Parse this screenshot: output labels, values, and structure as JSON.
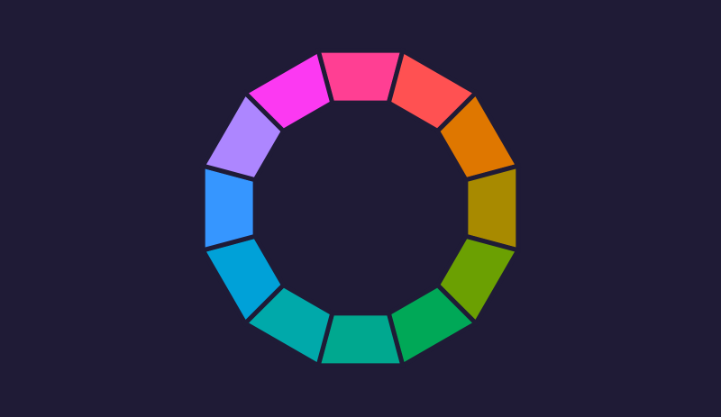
{
  "background_color": "#1f1b36",
  "color_wheel": {
    "segments": [
      {
        "name": "rose",
        "color": "#ff3f93"
      },
      {
        "name": "red",
        "color": "#ff5152"
      },
      {
        "name": "orange",
        "color": "#df7700"
      },
      {
        "name": "olive",
        "color": "#a88a00"
      },
      {
        "name": "yellow-green",
        "color": "#6ba002"
      },
      {
        "name": "green",
        "color": "#00a857"
      },
      {
        "name": "teal",
        "color": "#00a88f"
      },
      {
        "name": "cyan",
        "color": "#00a9aa"
      },
      {
        "name": "sky-blue",
        "color": "#00a1d8"
      },
      {
        "name": "blue",
        "color": "#3696ff"
      },
      {
        "name": "lavender",
        "color": "#ad86ff"
      },
      {
        "name": "magenta",
        "color": "#fc39f2"
      }
    ]
  }
}
